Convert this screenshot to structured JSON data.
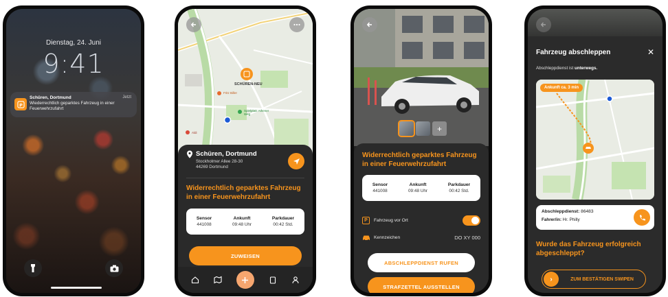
{
  "colors": {
    "accent": "#f7941d",
    "sheet": "#2a2a2a",
    "card": "#ffffff"
  },
  "lock": {
    "date": "Dienstag, 24. Juni",
    "time": "9:41",
    "notification": {
      "app_icon": "parking-p-icon",
      "title": "Schüren, Dortmund",
      "time": "Jetzt",
      "body": "Wiederrechtlich geparktes Fahrzeug in einer Feuerwehrzufahrt"
    },
    "icons": [
      "flashlight-icon",
      "camera-icon"
    ]
  },
  "map_screen": {
    "map_labels": {
      "district": "SCHÜREN-NEU",
      "poi1": "Spielplatz Athener Weg",
      "poi2": "Fritz Biller",
      "poi3": "Aldi"
    },
    "location": {
      "title": "Schüren, Dortmund",
      "street": "Stockholmer Allee 28-30",
      "city": "44269 Dortmund"
    },
    "violation": "Widerrechtlich geparktes Fahrzeug in einer Feuerwehrzufahrt",
    "stats": [
      {
        "label": "Sensor",
        "value": "441008"
      },
      {
        "label": "Ankunft",
        "value": "09:48 Uhr"
      },
      {
        "label": "Parkdauer",
        "value": "00:42 Std."
      }
    ],
    "assign_button": "ZUWEISEN",
    "tabs": [
      "home-icon",
      "map-icon",
      "add-icon",
      "clipboard-icon",
      "profile-icon"
    ]
  },
  "photo_screen": {
    "violation": "Widerrechtlich geparktes Fahrzeug in einer Feuerwehrzufahrt",
    "stats": [
      {
        "label": "Sensor",
        "value": "441008"
      },
      {
        "label": "Ankunft",
        "value": "09:48 Uhr"
      },
      {
        "label": "Parkdauer",
        "value": "00:42 Std."
      }
    ],
    "vehicle_present_label": "Fahrzeug vor Ort",
    "vehicle_present": true,
    "plate_label": "Kennzeichen",
    "plate_value": "DO XY 000",
    "call_tow_button": "ABSCHLEPPDIENST RUFEN",
    "ticket_button": "STRAFZETTEL AUSSTELLEN"
  },
  "tow_screen": {
    "title": "Fahrzeug abschleppen",
    "status_prefix": "Abschleppdienst ist ",
    "status_value": "unterwegs.",
    "eta": "Ankunft ca. 3 min",
    "service_label": "Abschleppdienst:",
    "service_value": "86483",
    "driver_label": "Fahrer/in:",
    "driver_value": "Hr. Philly",
    "question": "Wurde das Fahrzeug erfolgreich abgeschleppt?",
    "swipe_label": "ZUM BESTÄTIGEN SWIPEN"
  }
}
